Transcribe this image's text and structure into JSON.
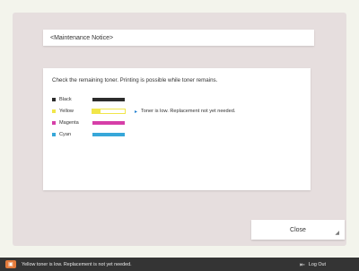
{
  "dialog": {
    "title": "<Maintenance Notice>",
    "message": "Check the remaining toner. Printing is possible while toner remains.",
    "close_label": "Close"
  },
  "toners": [
    {
      "name": "Black",
      "color": "#2c2c2c",
      "level": 1.0,
      "warning": ""
    },
    {
      "name": "Yellow",
      "color": "#f1e64a",
      "level": 0.25,
      "warning": "Toner is low. Replacement not yet needed."
    },
    {
      "name": "Magenta",
      "color": "#d63fa8",
      "level": 1.0,
      "warning": ""
    },
    {
      "name": "Cyan",
      "color": "#37a7d9",
      "level": 1.0,
      "warning": ""
    }
  ],
  "status_bar": {
    "message": "Yellow toner is low. Replacement is not yet needed.",
    "logout_label": "Log Out"
  },
  "icons": {
    "status": "printer-warning-icon",
    "logout": "logout-icon",
    "warning_arrow": "arrow-right-icon"
  }
}
